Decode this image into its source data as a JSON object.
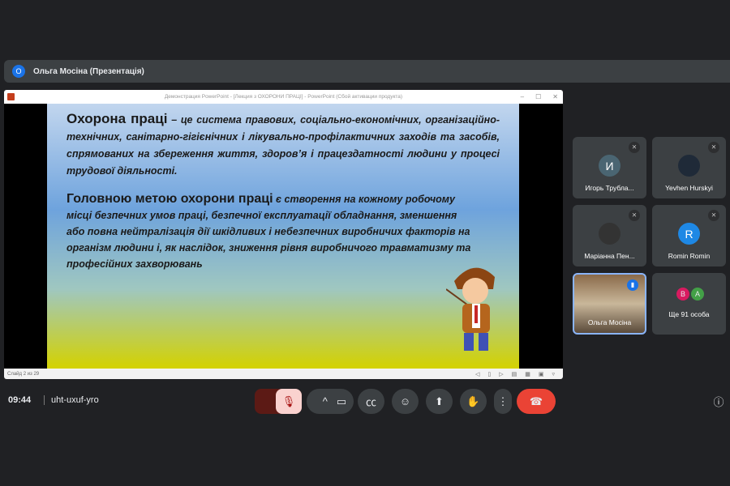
{
  "presenter": {
    "initial": "О",
    "title": "Ольга Мосіна (Презентація)"
  },
  "ppt": {
    "window_title": "Демонстрация PowerPoint - [Лекция з ОХОРОНИ ПРАЦІ] - PowerPoint (Сбой активации продукта)",
    "status": "Слайд 2 из 29",
    "p1_head": "Охорона праці",
    "p1_lines": [
      " – це система правових, соціально-економічних, організаційно-технічних, санітарно-гігієнічних і лікувально-профілактичних заходів та засобів, спрямованих на збереження життя, здоров’я і працездатності людини у процесі трудової діяльності."
    ],
    "p2_head": "Головною метою охорони праці",
    "p2_text": " є створення на кожному робочому місці безпечних умов праці, безпечної експлуатації обладнання, зменшення або повна нейтралізація дії шкідливих і небезпечних виробничих факторів на організм людини і, як наслідок, зниження рівня виробничого травматизму та професійних захворювань"
  },
  "participants": [
    {
      "name": "Игорь Трубла...",
      "initial": "И",
      "color": "#4a6572",
      "muted": true
    },
    {
      "name": "Yevhen Hurskyi",
      "muted": true
    },
    {
      "name": "Маріанна Пен...",
      "muted": true
    },
    {
      "name": "Romin Romin",
      "initial": "R",
      "color": "#1e88e5",
      "muted": true
    },
    {
      "name": "Ольга Мосіна",
      "speaking": true
    },
    {
      "name": "Ще 91 особа",
      "a": "B",
      "b": "A",
      "color_a": "#d81b60",
      "color_b": "#43a047"
    }
  ],
  "meeting": {
    "time": "09:44",
    "code": "uht-uxuf-yro"
  },
  "colors": {
    "background": "#202124",
    "end_call": "#ea4335",
    "mic_off": "#fad2cf"
  }
}
